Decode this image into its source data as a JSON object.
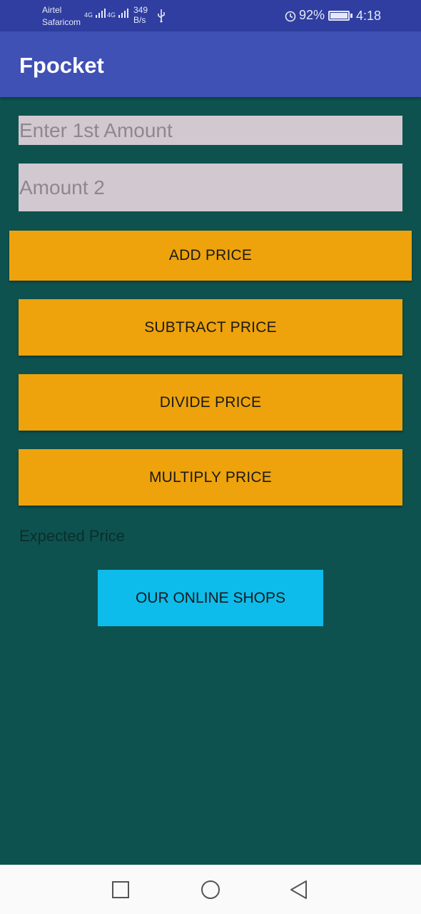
{
  "status_bar": {
    "carrier1": "Airtel",
    "carrier2": "Safaricom",
    "net1": "4G",
    "net2": "4G",
    "speed_value": "349",
    "speed_unit": "B/s",
    "battery": "92%",
    "time": "4:18",
    "icons": [
      "signal-icon",
      "usb-icon",
      "alarm-icon",
      "battery-icon"
    ]
  },
  "app_bar": {
    "title": "Fpocket"
  },
  "form": {
    "amount1_placeholder": "Enter 1st Amount",
    "amount2_placeholder": "Amount 2"
  },
  "buttons": {
    "add": "ADD PRICE",
    "subtract": "SUBTRACT PRICE",
    "divide": "DIVIDE PRICE",
    "multiply": "MULTIPLY PRICE",
    "shops": "OUR ONLINE SHOPS"
  },
  "result": {
    "label": "Expected Price"
  },
  "colors": {
    "status_bar": "#2f3ea0",
    "app_bar": "#3f51b5",
    "background": "#0e524f",
    "field": "#d2c8d0",
    "button": "#eea30c",
    "shops_button": "#0dbceb"
  },
  "nav_bar": {
    "icons": [
      "recents-square-icon",
      "home-circle-icon",
      "back-triangle-icon"
    ]
  }
}
